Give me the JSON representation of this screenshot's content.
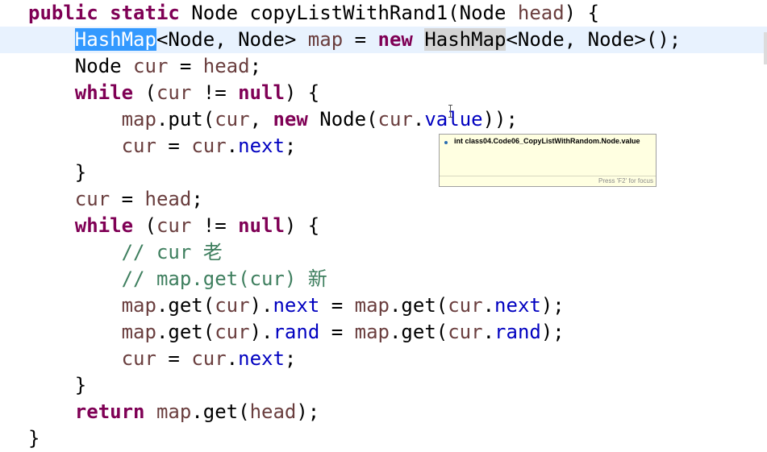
{
  "editor": {
    "lines": [
      {
        "indent": "",
        "tokens": [
          {
            "t": "public static",
            "c": "kw"
          },
          {
            "t": " Node copyListWithRand1(Node ",
            "c": "plain"
          },
          {
            "t": "head",
            "c": "var"
          },
          {
            "t": ") {",
            "c": "plain"
          }
        ]
      },
      {
        "indent": "    ",
        "current": true,
        "tokens": [
          {
            "t": "HashMap",
            "c": "plain",
            "hl": "sel"
          },
          {
            "t": "<Node, Node> ",
            "c": "plain"
          },
          {
            "t": "map",
            "c": "var"
          },
          {
            "t": " = ",
            "c": "plain"
          },
          {
            "t": "new",
            "c": "kw"
          },
          {
            "t": " ",
            "c": "plain"
          },
          {
            "t": "HashMap",
            "c": "plain",
            "hl": "occ"
          },
          {
            "t": "<Node, Node>();",
            "c": "plain"
          }
        ]
      },
      {
        "indent": "    ",
        "tokens": [
          {
            "t": "Node ",
            "c": "plain"
          },
          {
            "t": "cur",
            "c": "var"
          },
          {
            "t": " = ",
            "c": "plain"
          },
          {
            "t": "head",
            "c": "var"
          },
          {
            "t": ";",
            "c": "plain"
          }
        ]
      },
      {
        "indent": "    ",
        "tokens": [
          {
            "t": "while",
            "c": "kw"
          },
          {
            "t": " (",
            "c": "plain"
          },
          {
            "t": "cur",
            "c": "var"
          },
          {
            "t": " != ",
            "c": "plain"
          },
          {
            "t": "null",
            "c": "kw"
          },
          {
            "t": ") {",
            "c": "plain"
          }
        ]
      },
      {
        "indent": "        ",
        "tokens": [
          {
            "t": "map",
            "c": "var"
          },
          {
            "t": ".put(",
            "c": "plain"
          },
          {
            "t": "cur",
            "c": "var"
          },
          {
            "t": ", ",
            "c": "plain"
          },
          {
            "t": "new",
            "c": "kw"
          },
          {
            "t": " Node(",
            "c": "plain"
          },
          {
            "t": "cur",
            "c": "var"
          },
          {
            "t": ".",
            "c": "plain"
          },
          {
            "t": "value",
            "c": "field"
          },
          {
            "t": "));",
            "c": "plain"
          }
        ]
      },
      {
        "indent": "        ",
        "tokens": [
          {
            "t": "cur",
            "c": "var"
          },
          {
            "t": " = ",
            "c": "plain"
          },
          {
            "t": "cur",
            "c": "var"
          },
          {
            "t": ".",
            "c": "plain"
          },
          {
            "t": "next",
            "c": "field"
          },
          {
            "t": ";",
            "c": "plain"
          }
        ]
      },
      {
        "indent": "    ",
        "tokens": [
          {
            "t": "}",
            "c": "plain"
          }
        ]
      },
      {
        "indent": "    ",
        "tokens": [
          {
            "t": "cur",
            "c": "var"
          },
          {
            "t": " = ",
            "c": "plain"
          },
          {
            "t": "head",
            "c": "var"
          },
          {
            "t": ";",
            "c": "plain"
          }
        ]
      },
      {
        "indent": "    ",
        "tokens": [
          {
            "t": "while",
            "c": "kw"
          },
          {
            "t": " (",
            "c": "plain"
          },
          {
            "t": "cur",
            "c": "var"
          },
          {
            "t": " != ",
            "c": "plain"
          },
          {
            "t": "null",
            "c": "kw"
          },
          {
            "t": ") {",
            "c": "plain"
          }
        ]
      },
      {
        "indent": "        ",
        "tokens": [
          {
            "t": "// cur 老",
            "c": "comment"
          }
        ]
      },
      {
        "indent": "        ",
        "tokens": [
          {
            "t": "// map.get(cur) 新",
            "c": "comment"
          }
        ]
      },
      {
        "indent": "        ",
        "tokens": [
          {
            "t": "map",
            "c": "var"
          },
          {
            "t": ".get(",
            "c": "plain"
          },
          {
            "t": "cur",
            "c": "var"
          },
          {
            "t": ").",
            "c": "plain"
          },
          {
            "t": "next",
            "c": "field"
          },
          {
            "t": " = ",
            "c": "plain"
          },
          {
            "t": "map",
            "c": "var"
          },
          {
            "t": ".get(",
            "c": "plain"
          },
          {
            "t": "cur",
            "c": "var"
          },
          {
            "t": ".",
            "c": "plain"
          },
          {
            "t": "next",
            "c": "field"
          },
          {
            "t": ");",
            "c": "plain"
          }
        ]
      },
      {
        "indent": "        ",
        "tokens": [
          {
            "t": "map",
            "c": "var"
          },
          {
            "t": ".get(",
            "c": "plain"
          },
          {
            "t": "cur",
            "c": "var"
          },
          {
            "t": ").",
            "c": "plain"
          },
          {
            "t": "rand",
            "c": "field"
          },
          {
            "t": " = ",
            "c": "plain"
          },
          {
            "t": "map",
            "c": "var"
          },
          {
            "t": ".get(",
            "c": "plain"
          },
          {
            "t": "cur",
            "c": "var"
          },
          {
            "t": ".",
            "c": "plain"
          },
          {
            "t": "rand",
            "c": "field"
          },
          {
            "t": ");",
            "c": "plain"
          }
        ]
      },
      {
        "indent": "        ",
        "tokens": [
          {
            "t": "cur",
            "c": "var"
          },
          {
            "t": " = ",
            "c": "plain"
          },
          {
            "t": "cur",
            "c": "var"
          },
          {
            "t": ".",
            "c": "plain"
          },
          {
            "t": "next",
            "c": "field"
          },
          {
            "t": ";",
            "c": "plain"
          }
        ]
      },
      {
        "indent": "    ",
        "tokens": [
          {
            "t": "}",
            "c": "plain"
          }
        ]
      },
      {
        "indent": "    ",
        "tokens": [
          {
            "t": "return",
            "c": "kw"
          },
          {
            "t": " ",
            "c": "plain"
          },
          {
            "t": "map",
            "c": "var"
          },
          {
            "t": ".get(",
            "c": "plain"
          },
          {
            "t": "head",
            "c": "var"
          },
          {
            "t": ");",
            "c": "plain"
          }
        ]
      },
      {
        "indent": "",
        "tokens": [
          {
            "t": "}",
            "c": "plain"
          }
        ]
      }
    ]
  },
  "hover": {
    "icon": "field-dot-icon",
    "signature": "int class04.Code06_CopyListWithRandom.Node.value",
    "footer": "Press 'F2' for focus"
  },
  "colors": {
    "keyword": "#7f0055",
    "variable": "#6a3e3e",
    "field": "#0000c0",
    "comment": "#3f7f5f",
    "selection": "#3399ff",
    "current_line": "#e8f2fe",
    "tooltip_bg": "#ffffe1"
  }
}
